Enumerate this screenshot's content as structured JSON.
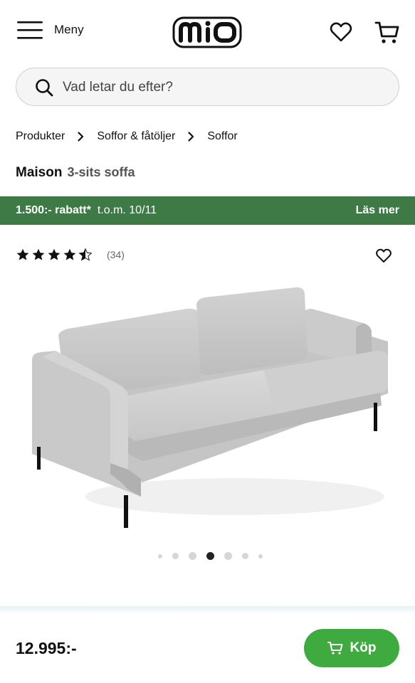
{
  "header": {
    "menu_label": "Meny",
    "logo_text": "mio",
    "menu_icon": "hamburger-icon",
    "wishlist_icon": "heart-icon",
    "cart_icon": "cart-icon"
  },
  "search": {
    "placeholder": "Vad letar du efter?",
    "value": "",
    "icon": "search-icon"
  },
  "breadcrumb": {
    "items": [
      "Produkter",
      "Soffor & fåtöljer",
      "Soffor"
    ]
  },
  "product": {
    "brand": "Maison",
    "model": "3-sits soffa",
    "rating": 4.5,
    "rating_max": 5,
    "review_count": "(34)",
    "image_icon": "gray-3-seat-sofa",
    "gallery": {
      "count": 7,
      "active_index": 3
    }
  },
  "promo": {
    "amount": "1.500:- rabatt*",
    "period": "t.o.m. 10/11",
    "read_more": "Läs mer",
    "color": "#3e7a46"
  },
  "purchase": {
    "price": "12.995:-",
    "buy_label": "Köp",
    "buy_color": "#3faa3f"
  }
}
